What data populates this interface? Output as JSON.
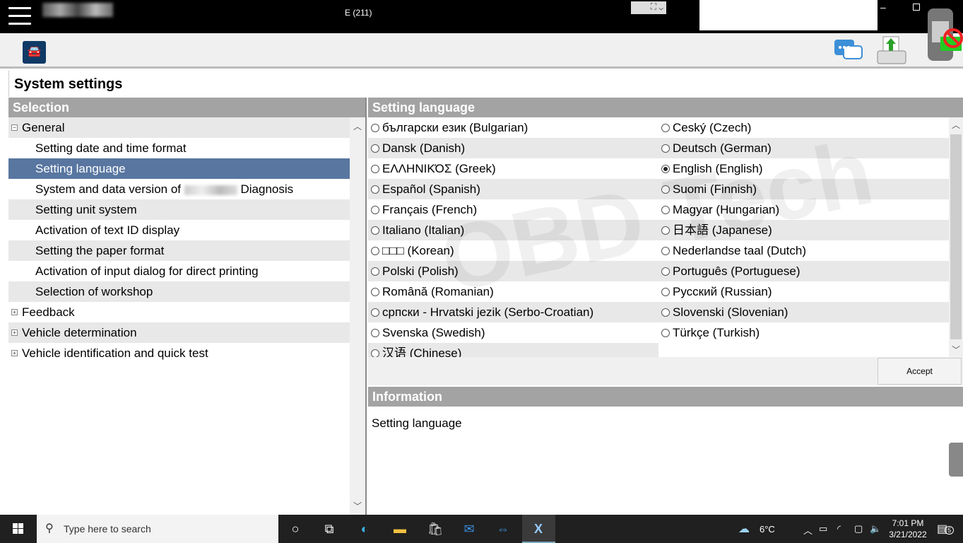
{
  "titlebar": {
    "title": "E (211)"
  },
  "header": {
    "title": "System settings"
  },
  "left": {
    "heading": "Selection",
    "items": [
      {
        "label": "General",
        "level": 0,
        "toggle": "⊟"
      },
      {
        "label": "Setting date and time format",
        "level": 1
      },
      {
        "label": "Setting language",
        "level": 1,
        "selected": true
      },
      {
        "label_before": "System and data version of",
        "label_after": "Diagnosis",
        "level": 1
      },
      {
        "label": "Setting unit system",
        "level": 1
      },
      {
        "label": "Activation of text ID display",
        "level": 1
      },
      {
        "label": "Setting the paper format",
        "level": 1
      },
      {
        "label": "Activation of input dialog for direct printing",
        "level": 1
      },
      {
        "label": "Selection of workshop",
        "level": 1
      },
      {
        "label": "Feedback",
        "level": 0,
        "toggle": "⊞"
      },
      {
        "label": "Vehicle determination",
        "level": 0,
        "toggle": "⊞"
      },
      {
        "label": "Vehicle identification and quick test",
        "level": 0,
        "toggle": "⊞"
      }
    ]
  },
  "right": {
    "heading": "Setting language",
    "languages": [
      [
        "български език (Bulgarian)",
        "Ceský (Czech)"
      ],
      [
        "Dansk (Danish)",
        "Deutsch (German)"
      ],
      [
        "ΕΛΛΗΝΙΚΌΣ (Greek)",
        "English (English)"
      ],
      [
        "Español (Spanish)",
        "Suomi (Finnish)"
      ],
      [
        "Français (French)",
        "Magyar (Hungarian)"
      ],
      [
        "Italiano (Italian)",
        "日本語 (Japanese)"
      ],
      [
        "□□□ (Korean)",
        "Nederlandse taal (Dutch)"
      ],
      [
        "Polski (Polish)",
        "Português (Portuguese)"
      ],
      [
        "Română (Romanian)",
        "Русский (Russian)"
      ],
      [
        "српски - Hrvatski jezik (Serbo-Croatian)",
        "Slovenski (Slovenian)"
      ],
      [
        "Svenska (Swedish)",
        "Türkçe (Turkish)"
      ],
      [
        "汉语 (Chinese)",
        ""
      ]
    ],
    "selected_language": "English (English)",
    "accept_label": "Accept",
    "info_heading": "Information",
    "info_text": "Setting language"
  },
  "watermark": "OBD Tech",
  "taskbar": {
    "search_placeholder": "Type here to search",
    "weather": "6°C",
    "time": "7:01 PM",
    "date": "3/21/2022",
    "notifications": "5"
  },
  "colors": {
    "selection": "#5876a0",
    "panel_header": "#a3a3a3",
    "car_button": "#0f3a66"
  }
}
